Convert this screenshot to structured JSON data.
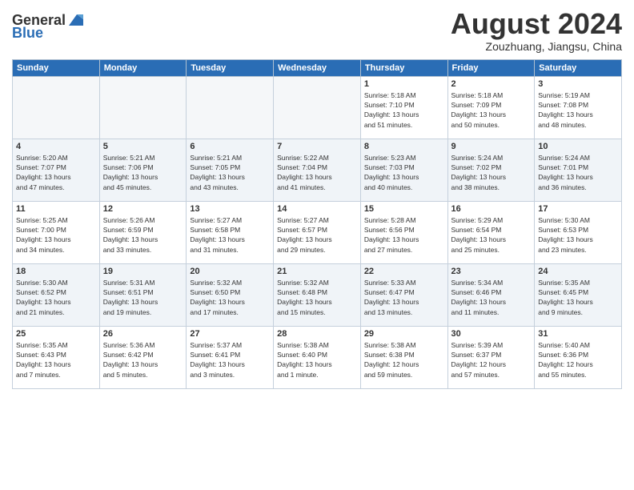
{
  "app": {
    "name": "GeneralBlue",
    "title": "August 2024",
    "location": "Zouzhuang, Jiangsu, China"
  },
  "days_of_week": [
    "Sunday",
    "Monday",
    "Tuesday",
    "Wednesday",
    "Thursday",
    "Friday",
    "Saturday"
  ],
  "weeks": [
    [
      {
        "day": "",
        "info": ""
      },
      {
        "day": "",
        "info": ""
      },
      {
        "day": "",
        "info": ""
      },
      {
        "day": "",
        "info": ""
      },
      {
        "day": "1",
        "info": "Sunrise: 5:18 AM\nSunset: 7:10 PM\nDaylight: 13 hours\nand 51 minutes."
      },
      {
        "day": "2",
        "info": "Sunrise: 5:18 AM\nSunset: 7:09 PM\nDaylight: 13 hours\nand 50 minutes."
      },
      {
        "day": "3",
        "info": "Sunrise: 5:19 AM\nSunset: 7:08 PM\nDaylight: 13 hours\nand 48 minutes."
      }
    ],
    [
      {
        "day": "4",
        "info": "Sunrise: 5:20 AM\nSunset: 7:07 PM\nDaylight: 13 hours\nand 47 minutes."
      },
      {
        "day": "5",
        "info": "Sunrise: 5:21 AM\nSunset: 7:06 PM\nDaylight: 13 hours\nand 45 minutes."
      },
      {
        "day": "6",
        "info": "Sunrise: 5:21 AM\nSunset: 7:05 PM\nDaylight: 13 hours\nand 43 minutes."
      },
      {
        "day": "7",
        "info": "Sunrise: 5:22 AM\nSunset: 7:04 PM\nDaylight: 13 hours\nand 41 minutes."
      },
      {
        "day": "8",
        "info": "Sunrise: 5:23 AM\nSunset: 7:03 PM\nDaylight: 13 hours\nand 40 minutes."
      },
      {
        "day": "9",
        "info": "Sunrise: 5:24 AM\nSunset: 7:02 PM\nDaylight: 13 hours\nand 38 minutes."
      },
      {
        "day": "10",
        "info": "Sunrise: 5:24 AM\nSunset: 7:01 PM\nDaylight: 13 hours\nand 36 minutes."
      }
    ],
    [
      {
        "day": "11",
        "info": "Sunrise: 5:25 AM\nSunset: 7:00 PM\nDaylight: 13 hours\nand 34 minutes."
      },
      {
        "day": "12",
        "info": "Sunrise: 5:26 AM\nSunset: 6:59 PM\nDaylight: 13 hours\nand 33 minutes."
      },
      {
        "day": "13",
        "info": "Sunrise: 5:27 AM\nSunset: 6:58 PM\nDaylight: 13 hours\nand 31 minutes."
      },
      {
        "day": "14",
        "info": "Sunrise: 5:27 AM\nSunset: 6:57 PM\nDaylight: 13 hours\nand 29 minutes."
      },
      {
        "day": "15",
        "info": "Sunrise: 5:28 AM\nSunset: 6:56 PM\nDaylight: 13 hours\nand 27 minutes."
      },
      {
        "day": "16",
        "info": "Sunrise: 5:29 AM\nSunset: 6:54 PM\nDaylight: 13 hours\nand 25 minutes."
      },
      {
        "day": "17",
        "info": "Sunrise: 5:30 AM\nSunset: 6:53 PM\nDaylight: 13 hours\nand 23 minutes."
      }
    ],
    [
      {
        "day": "18",
        "info": "Sunrise: 5:30 AM\nSunset: 6:52 PM\nDaylight: 13 hours\nand 21 minutes."
      },
      {
        "day": "19",
        "info": "Sunrise: 5:31 AM\nSunset: 6:51 PM\nDaylight: 13 hours\nand 19 minutes."
      },
      {
        "day": "20",
        "info": "Sunrise: 5:32 AM\nSunset: 6:50 PM\nDaylight: 13 hours\nand 17 minutes."
      },
      {
        "day": "21",
        "info": "Sunrise: 5:32 AM\nSunset: 6:48 PM\nDaylight: 13 hours\nand 15 minutes."
      },
      {
        "day": "22",
        "info": "Sunrise: 5:33 AM\nSunset: 6:47 PM\nDaylight: 13 hours\nand 13 minutes."
      },
      {
        "day": "23",
        "info": "Sunrise: 5:34 AM\nSunset: 6:46 PM\nDaylight: 13 hours\nand 11 minutes."
      },
      {
        "day": "24",
        "info": "Sunrise: 5:35 AM\nSunset: 6:45 PM\nDaylight: 13 hours\nand 9 minutes."
      }
    ],
    [
      {
        "day": "25",
        "info": "Sunrise: 5:35 AM\nSunset: 6:43 PM\nDaylight: 13 hours\nand 7 minutes."
      },
      {
        "day": "26",
        "info": "Sunrise: 5:36 AM\nSunset: 6:42 PM\nDaylight: 13 hours\nand 5 minutes."
      },
      {
        "day": "27",
        "info": "Sunrise: 5:37 AM\nSunset: 6:41 PM\nDaylight: 13 hours\nand 3 minutes."
      },
      {
        "day": "28",
        "info": "Sunrise: 5:38 AM\nSunset: 6:40 PM\nDaylight: 13 hours\nand 1 minute."
      },
      {
        "day": "29",
        "info": "Sunrise: 5:38 AM\nSunset: 6:38 PM\nDaylight: 12 hours\nand 59 minutes."
      },
      {
        "day": "30",
        "info": "Sunrise: 5:39 AM\nSunset: 6:37 PM\nDaylight: 12 hours\nand 57 minutes."
      },
      {
        "day": "31",
        "info": "Sunrise: 5:40 AM\nSunset: 6:36 PM\nDaylight: 12 hours\nand 55 minutes."
      }
    ]
  ]
}
